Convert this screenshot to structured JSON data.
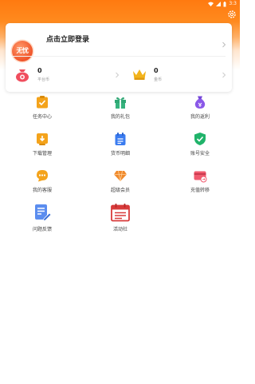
{
  "colors": {
    "accent": "#ff7a10",
    "avatar": "#f0542a",
    "coin": "#f04e5e",
    "crown": "#f2b31b"
  },
  "user": {
    "avatar_text": "无忧",
    "login_prompt": "点击立即登录"
  },
  "stats": [
    {
      "value": "0",
      "label": "平台币",
      "icon": "coin-pouch-icon"
    },
    {
      "value": "0",
      "label": "金币",
      "icon": "crown-icon"
    }
  ],
  "menu": [
    {
      "label": "任务中心",
      "icon": "task-clipboard-icon",
      "color": "#f4a31b"
    },
    {
      "label": "我的礼包",
      "icon": "gift-icon",
      "color": "#36b37e"
    },
    {
      "label": "我的返利",
      "icon": "rebate-purse-icon",
      "color": "#8a58e8"
    },
    {
      "label": "下载管理",
      "icon": "download-box-icon",
      "color": "#f4a31b"
    },
    {
      "label": "货币明细",
      "icon": "calendar-list-icon",
      "color": "#3b7cf0"
    },
    {
      "label": "账号安全",
      "icon": "shield-check-icon",
      "color": "#20b36a"
    },
    {
      "label": "我的客服",
      "icon": "chat-bubble-icon",
      "color": "#f4a31b"
    },
    {
      "label": "超级会员",
      "icon": "diamond-icon",
      "color": "#f08a2c"
    },
    {
      "label": "充值转移",
      "icon": "card-transfer-icon",
      "color": "#f05a6e"
    },
    {
      "label": "问题反馈",
      "icon": "feedback-doc-icon",
      "color": "#5b8def"
    },
    {
      "label": "活动社",
      "icon": "event-calendar-icon",
      "color": "#d83a3a"
    }
  ]
}
